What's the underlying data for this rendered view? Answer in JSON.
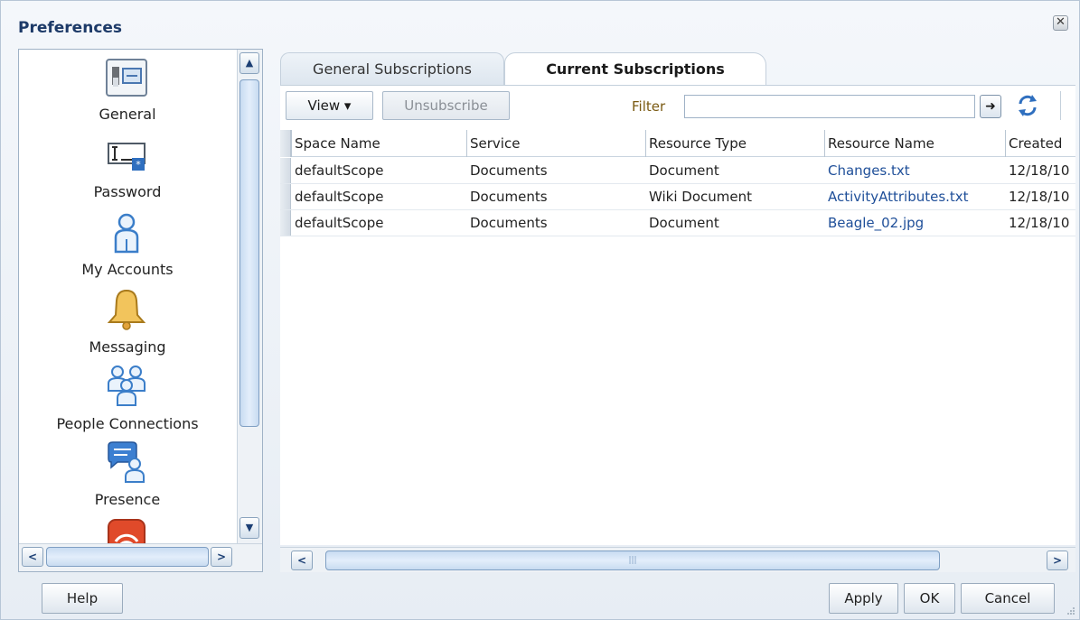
{
  "dialog": {
    "title": "Preferences",
    "close_icon": "close-icon"
  },
  "nav": {
    "items": [
      {
        "label": "General",
        "icon": "general-settings-icon"
      },
      {
        "label": "Password",
        "icon": "password-icon"
      },
      {
        "label": "My Accounts",
        "icon": "user-account-icon"
      },
      {
        "label": "Messaging",
        "icon": "bell-icon"
      },
      {
        "label": "People Connections",
        "icon": "people-icon"
      },
      {
        "label": "Presence",
        "icon": "presence-chat-icon"
      },
      {
        "label": "",
        "icon": "feed-icon"
      }
    ]
  },
  "tabs": [
    {
      "label": "General Subscriptions",
      "selected": false
    },
    {
      "label": "Current Subscriptions",
      "selected": true
    }
  ],
  "toolbar": {
    "view_label": "View ▾",
    "unsubscribe_label": "Unsubscribe",
    "filter_label": "Filter",
    "filter_value": "",
    "go_icon": "arrow-right-icon",
    "refresh_icon": "refresh-icon"
  },
  "table": {
    "columns": [
      "Space Name",
      "Service",
      "Resource Type",
      "Resource Name",
      "Created"
    ],
    "rows": [
      [
        "defaultScope",
        "Documents",
        "Document",
        "Changes.txt",
        "12/18/10"
      ],
      [
        "defaultScope",
        "Documents",
        "Wiki Document",
        "ActivityAttributes.txt",
        "12/18/10"
      ],
      [
        "defaultScope",
        "Documents",
        "Document",
        "Beagle_02.jpg",
        "12/18/10"
      ]
    ]
  },
  "footer": {
    "help": "Help",
    "apply": "Apply",
    "ok": "OK",
    "cancel": "Cancel"
  },
  "colors": {
    "title": "#1d3a68",
    "link": "#1f4f99",
    "filter": "#7a5a12"
  }
}
